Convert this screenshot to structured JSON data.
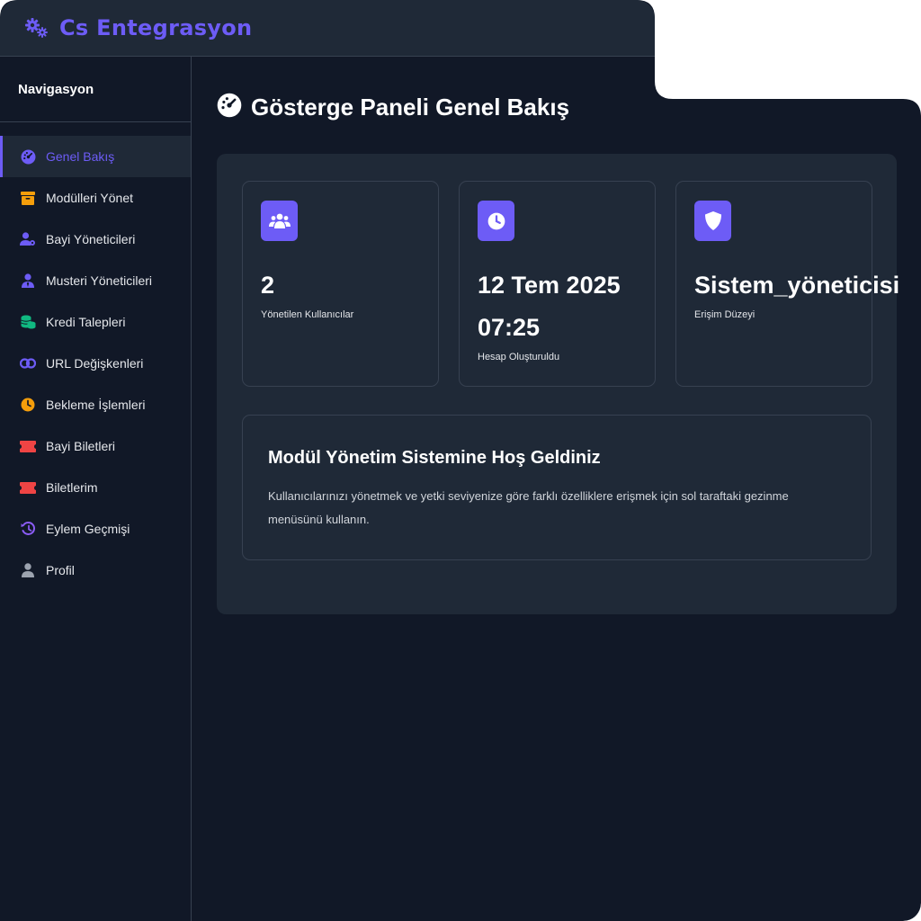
{
  "app": {
    "title": "Cs Entegrasyon",
    "logo_icon": "gears-icon",
    "accent": "#6d5cf6"
  },
  "sidebar": {
    "title": "Navigasyon",
    "items": [
      {
        "label": "Genel Bakış",
        "icon": "dashboard-gauge-icon",
        "active": true
      },
      {
        "label": "Modülleri Yönet",
        "icon": "box-icon"
      },
      {
        "label": "Bayi Yöneticileri",
        "icon": "user-gear-icon"
      },
      {
        "label": "Musteri Yöneticileri",
        "icon": "user-tie-icon"
      },
      {
        "label": "Kredi Talepleri",
        "icon": "coins-icon"
      },
      {
        "label": "URL Değişkenleri",
        "icon": "link-icon"
      },
      {
        "label": "Bekleme İşlemleri",
        "icon": "clock-icon"
      },
      {
        "label": "Bayi Biletleri",
        "icon": "ticket-icon"
      },
      {
        "label": "Biletlerim",
        "icon": "ticket-icon"
      },
      {
        "label": "Eylem Geçmişi",
        "icon": "history-icon"
      },
      {
        "label": "Profil",
        "icon": "user-icon"
      }
    ]
  },
  "main": {
    "title": "Gösterge Paneli Genel Bakış",
    "cards": [
      {
        "icon": "users-icon",
        "value": "2",
        "label": "Yönetilen Kullanıcılar"
      },
      {
        "icon": "clock-icon",
        "value": "12 Tem 2025 07:25",
        "label": "Hesap Oluşturuldu"
      },
      {
        "icon": "shield-icon",
        "value": "Sistem_yöneticisi",
        "label": "Erişim Düzeyi"
      }
    ],
    "welcome": {
      "title": "Modül Yönetim Sistemine Hoş Geldiniz",
      "text": "Kullanıcılarınızı yönetmek ve yetki seviyenize göre farklı özelliklere erişmek için sol taraftaki gezinme menüsünü kullanın."
    }
  }
}
